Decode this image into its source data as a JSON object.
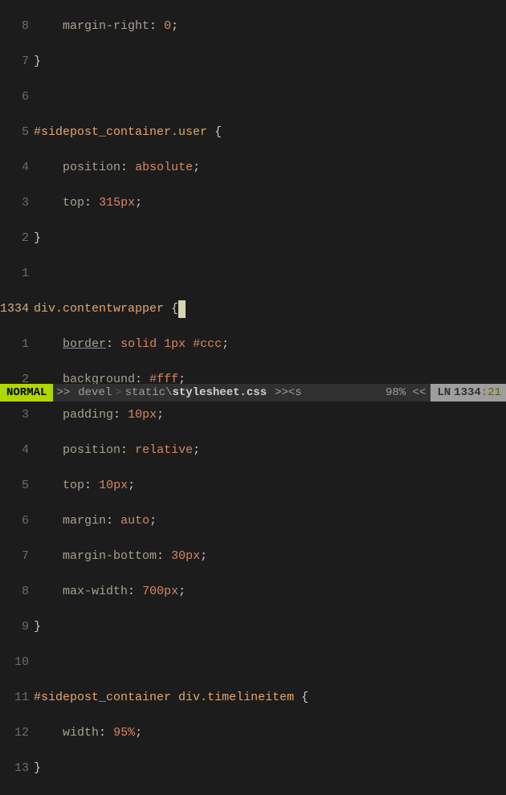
{
  "relnums": [
    "8",
    "7",
    "6",
    "5",
    "4",
    "3",
    "2",
    "1",
    "1334",
    "1",
    "2",
    "3",
    "4",
    "5",
    "6",
    "7",
    "8",
    "9",
    "10",
    "11",
    "12",
    "13"
  ],
  "code": {
    "l0": "margin-right",
    "l0v": "0",
    "l1": "}",
    "l3sel": "#sidepost_container",
    "l3cls": ".user",
    "l4p": "position",
    "l4v": "absolute",
    "l5p": "top",
    "l5v": "315px",
    "l6": "}",
    "l8sel": "div",
    "l8cls": ".contentwrapper",
    "l9p": "border",
    "l9v": "solid 1px #ccc",
    "l10p": "background",
    "l10v": "#fff",
    "l11p": "padding",
    "l11v": "10px",
    "l12p": "position",
    "l12v": "relative",
    "l13p": "top",
    "l13v": "10px",
    "l14p": "margin",
    "l14v": "auto",
    "l15p": "margin-bottom",
    "l15v": "30px",
    "l16p": "max-width",
    "l16v": "700px",
    "l17": "}",
    "l19sel": "#sidepost_container",
    "l19sel2": "div",
    "l19cls": ".timelineitem",
    "l20p": "width",
    "l20v": "95%",
    "l21": "}"
  },
  "status": {
    "mode": "NORMAL",
    "sep": ">>",
    "seg1": "devel",
    "seg2": "static",
    "file": "stylesheet.css",
    "right_s": ">><s",
    "pct": "98% <<",
    "ln_label": "LN ",
    "ln": "1334",
    "col": ":21"
  }
}
